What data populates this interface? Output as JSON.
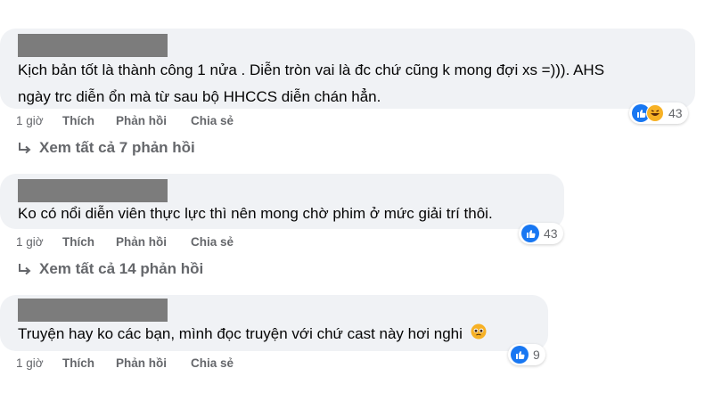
{
  "comments": [
    {
      "text_line1": "Kịch bản tốt là thành công 1 nửa . Diễn tròn vai là đc chứ cũng k mong đợi xs =))). AHS",
      "text_line2": "ngày trc diễn ổn mà từ sau bộ HHCCS diễn chán hẳn.",
      "time": "1 giờ",
      "like_label": "Thích",
      "reply_label": "Phản hồi",
      "share_label": "Chia sẻ",
      "reaction_count": "43",
      "reactions": [
        "like-icon",
        "haha-icon"
      ],
      "view_replies": "Xem tất cả 7 phản hồi"
    },
    {
      "text_line1": "Ko có nổi diễn viên thực lực thì nên mong chờ phim ở mức giải trí thôi.",
      "time": "1 giờ",
      "like_label": "Thích",
      "reply_label": "Phản hồi",
      "share_label": "Chia sẻ",
      "reaction_count": "43",
      "reactions": [
        "like-icon"
      ],
      "view_replies": "Xem tất cả 14 phản hồi"
    },
    {
      "text_line1": "Truyện hay ko các bạn, mình đọc truyện với chứ cast này hơi nghi",
      "time": "1 giờ",
      "like_label": "Thích",
      "reply_label": "Phản hồi",
      "share_label": "Chia sẻ",
      "reaction_count": "9",
      "reactions": [
        "like-icon"
      ],
      "emoji": "pleading-face-icon"
    }
  ],
  "colors": {
    "bubble_bg": "#f0f2f5",
    "meta_text": "#65676b",
    "like_blue": "#1877f2",
    "haha_yellow": "#f7b125"
  }
}
